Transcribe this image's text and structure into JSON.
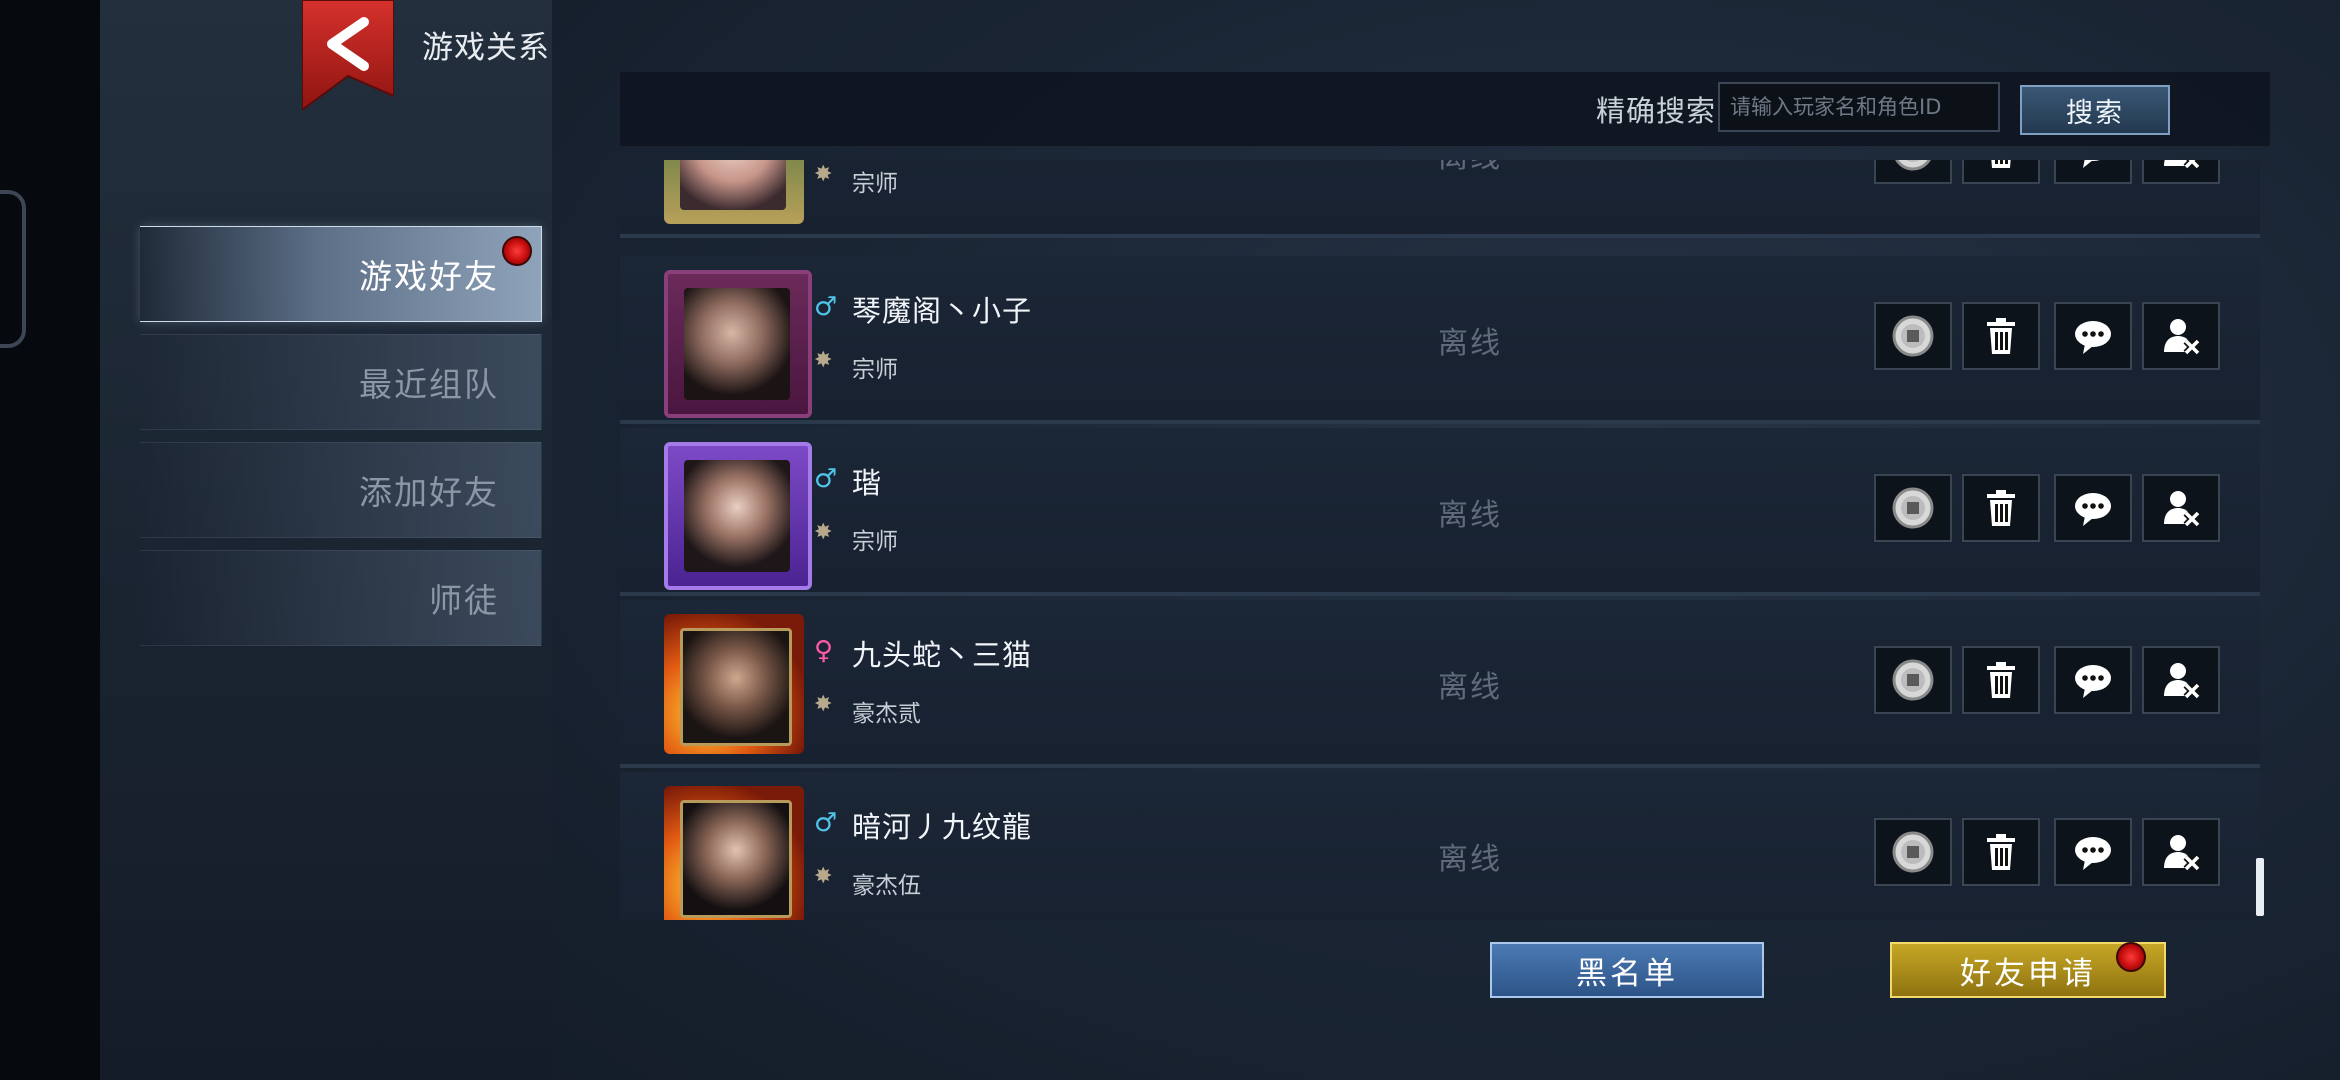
{
  "header": {
    "title": "游戏关系"
  },
  "sidebar": {
    "items": [
      {
        "label": "游戏好友",
        "active": true,
        "has_notification": true
      },
      {
        "label": "最近组队",
        "active": false
      },
      {
        "label": "添加好友",
        "active": false
      },
      {
        "label": "师徒",
        "active": false
      }
    ]
  },
  "search": {
    "label": "精确搜索",
    "placeholder": "请输入玩家名和角色ID",
    "value": "",
    "button_label": "搜索"
  },
  "friends": [
    {
      "name": "",
      "rank": "宗师",
      "status": "离线",
      "gender": "unknown"
    },
    {
      "name": "琴魔阁丶小子",
      "rank": "宗师",
      "status": "离线",
      "gender": "male",
      "gender_symbol": "♂"
    },
    {
      "name": "瑎",
      "rank": "宗师",
      "status": "离线",
      "gender": "male",
      "gender_symbol": "♂"
    },
    {
      "name": "九头蛇丶三猫",
      "rank": "豪杰贰",
      "status": "离线",
      "gender": "female",
      "gender_symbol": "♀"
    },
    {
      "name": "暗河丿九纹龍",
      "rank": "豪杰伍",
      "status": "离线",
      "gender": "male",
      "gender_symbol": "♂"
    }
  ],
  "row_actions": [
    "coin-icon",
    "trash-icon",
    "chat-bubble-icon",
    "remove-friend-icon"
  ],
  "footer": {
    "blacklist_label": "黑名单",
    "friend_request_label": "好友申请",
    "friend_request_notification": true
  },
  "colors": {
    "male": "#4fc3e8",
    "female": "#ff5aa5",
    "accent_gold": "#c7a726",
    "accent_blue": "#4b7ab3",
    "notification": "#e01b1b"
  }
}
